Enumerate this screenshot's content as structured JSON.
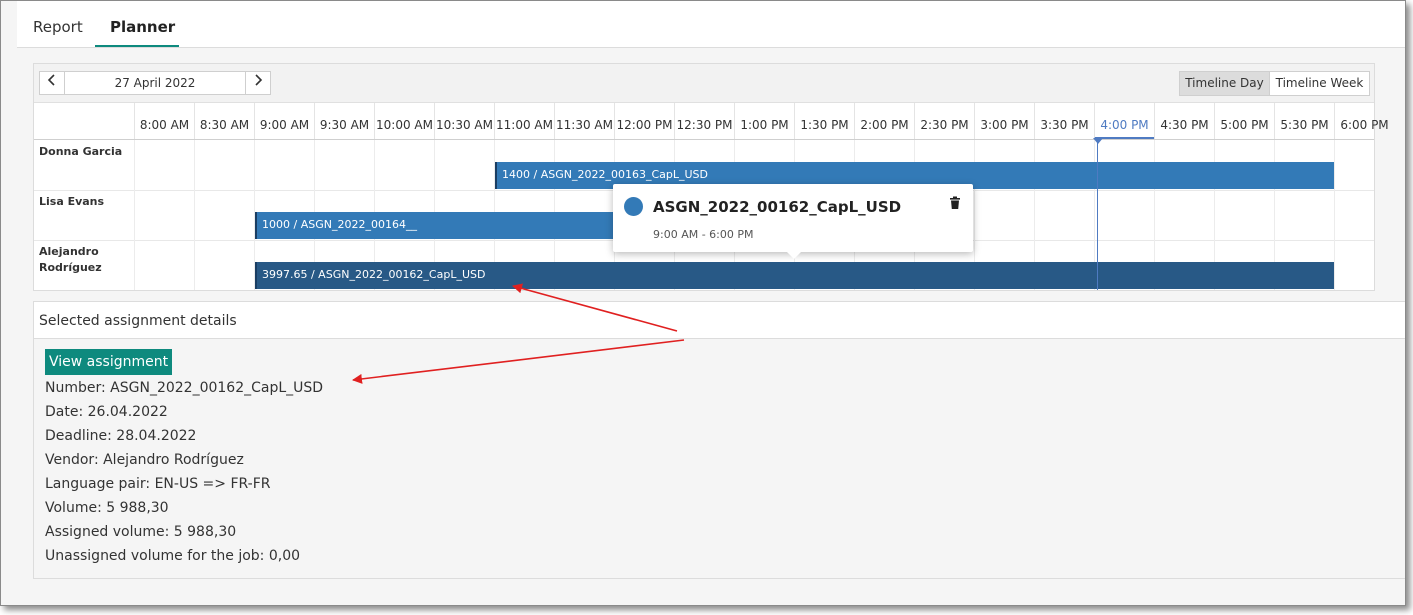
{
  "tabs": [
    {
      "label": "Report",
      "active": false
    },
    {
      "label": "Planner",
      "active": true
    }
  ],
  "toolbar": {
    "date": "27 April 2022",
    "prev_icon": "chevron-left-icon",
    "next_icon": "chevron-right-icon",
    "views": [
      "Timeline Day",
      "Timeline Week"
    ],
    "active_view": "Timeline Day"
  },
  "time_slots": [
    "8:00 AM",
    "8:30 AM",
    "9:00 AM",
    "9:30 AM",
    "10:00 AM",
    "10:30 AM",
    "11:00 AM",
    "11:30 AM",
    "12:00 PM",
    "12:30 PM",
    "1:00 PM",
    "1:30 PM",
    "2:00 PM",
    "2:30 PM",
    "3:00 PM",
    "3:30 PM",
    "4:00 PM",
    "4:30 PM",
    "5:00 PM",
    "5:30 PM",
    "6:00 PM"
  ],
  "current_slot": "4:00 PM",
  "resources": [
    {
      "name": "Donna Garcia"
    },
    {
      "name": "Lisa Evans"
    },
    {
      "name": "Alejandro Rodríguez"
    }
  ],
  "events": [
    {
      "label": "1400 / ASGN_2022_00163_CapL_USD",
      "resource": "Donna Garcia"
    },
    {
      "label": "1000 / ASGN_2022_00164__",
      "resource": "Lisa Evans"
    },
    {
      "label": "3997.65 / ASGN_2022_00162_CapL_USD",
      "resource": "Alejandro Rodríguez"
    }
  ],
  "popup": {
    "title": "ASGN_2022_00162_CapL_USD",
    "time": "9:00 AM - 6:00 PM",
    "delete_icon": "trash-icon"
  },
  "details": {
    "title": "Selected assignment details",
    "button": "View assignment",
    "lines": [
      "Number: ASGN_2022_00162_CapL_USD",
      "Date: 26.04.2022",
      "Deadline: 28.04.2022",
      "Vendor: Alejandro Rodríguez",
      "Language pair: EN-US => FR-FR",
      "Volume: 5 988,30",
      "Assigned volume: 5 988,30",
      "Unassigned volume for the job: 0,00"
    ]
  },
  "colors": {
    "accent": "#0e8a7e",
    "event": "#337ab7",
    "event_selected": "#285986",
    "now_indicator": "#4f7bc2",
    "annotation_arrow": "#e02020"
  }
}
